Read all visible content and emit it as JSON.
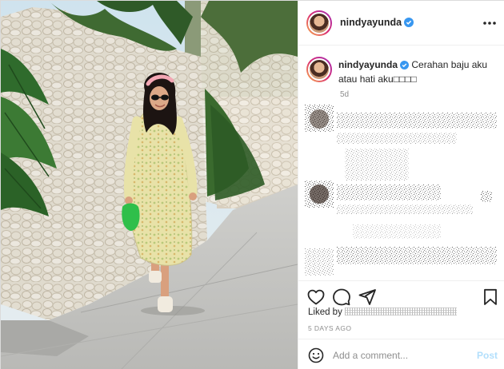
{
  "post": {
    "username": "nindyayunda",
    "caption_text": "Cerahan baju aku atau hati aku□□□□",
    "caption_time": "5d",
    "likes_prefix": "Liked by",
    "time_ago": "5 DAYS AGO",
    "comment_placeholder": "Add a comment...",
    "post_label": "Post"
  },
  "icons": {
    "verified": "verified-badge-icon",
    "more": "more-options-icon",
    "like": "heart-icon",
    "comment": "comment-icon",
    "share": "paper-plane-icon",
    "save": "bookmark-icon",
    "emoji": "emoji-icon"
  },
  "colors": {
    "verified_blue": "#3897f0",
    "post_disabled": "#b2dffc",
    "muted_text": "#8e8e8e"
  }
}
